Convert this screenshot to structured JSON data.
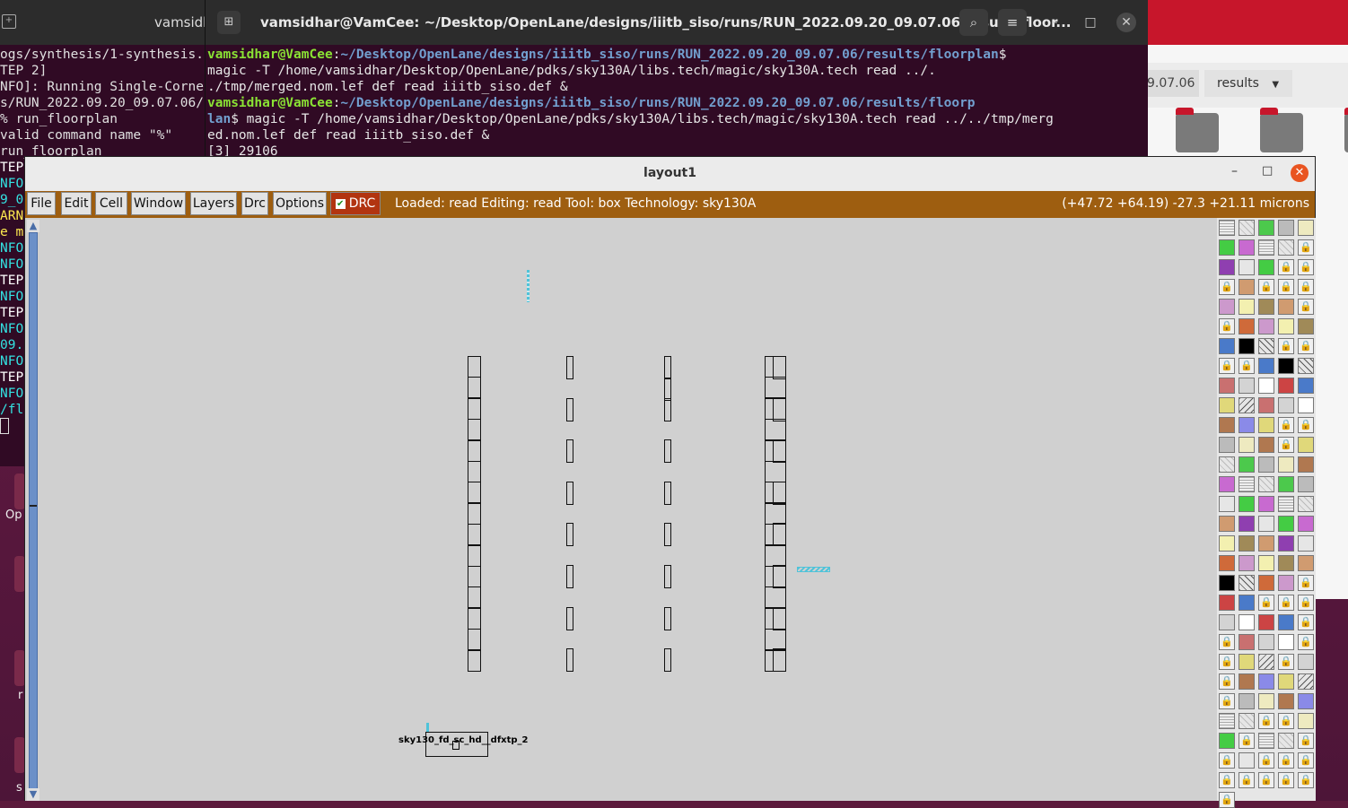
{
  "back_terminal": {
    "title": "vamsidh",
    "lines": [
      "ogs/synthesis/1-synthesis.",
      "TEP 2]",
      "NFO]: Running Single-Corne",
      "s/RUN_2022.09.20_09.07.06/",
      "% run_floorplan",
      "valid command name \"%\"",
      "run_floorplan",
      "TEP",
      "NFO",
      "9_0",
      "ARN",
      "e m",
      "NFO",
      "NFO",
      "TEP",
      "NFO",
      "TEP",
      "NFO",
      "09.",
      "NFO",
      "TEP",
      "NFO",
      "/fl"
    ]
  },
  "front_terminal": {
    "title": "vamsidhar@VamCee: ~/Desktop/OpenLane/designs/iiitb_siso/runs/RUN_2022.09.20_09.07.06/results/floor...",
    "line1_user": "vamsidhar@VamCee",
    "line1_path": "~/Desktop/OpenLane/designs/iiitb_siso/runs/RUN_2022.09.20_09.07.06/results/floorplan",
    "line1_end": "$",
    "line2": "magic -T /home/vamsidhar/Desktop/OpenLane/pdks/sky130A/libs.tech/magic/sky130A.tech read ../.",
    "line3": "./tmp/merged.nom.lef def read iiitb_siso.def &",
    "line4_user": "vamsidhar@VamCee",
    "line4_path": "~/Desktop/OpenLane/designs/iiitb_siso/runs/RUN_2022.09.20_09.07.06/results/floorp",
    "line5_path": "lan",
    "line5_rest": "$ magic -T /home/vamsidhar/Desktop/OpenLane/pdks/sky130A/libs.tech/magic/sky130A.tech read ../../tmp/merg",
    "line6": "ed.nom.lef def read iiitb_siso.def &",
    "line7": "[3] 29106"
  },
  "files": {
    "crumb_run": "9.07.06",
    "crumb_results": "results"
  },
  "dock": {
    "label_op": "Op",
    "label_r": "r",
    "label_s": "s"
  },
  "layout": {
    "title": "layout1",
    "menu": [
      "File",
      "Edit",
      "Cell",
      "Window",
      "Layers",
      "Drc",
      "Options"
    ],
    "drc_label": "DRC",
    "status": "Loaded: read Editing: read Tool: box  Technology: sky130A",
    "coords": "(+47.72 +64.19) -27.3 +21.11 microns",
    "cell_name": "sky130_fd_sc_hd__dfxtp_2"
  },
  "colors": {
    "terminal_bg": "#300a24",
    "prompt_user": "#8ae234",
    "prompt_path": "#729fcf",
    "menubar": "#9e5e10",
    "drc_button": "#b23410",
    "canvas": "#d0d0d0",
    "pin_cyan": "#4fc3d9"
  }
}
